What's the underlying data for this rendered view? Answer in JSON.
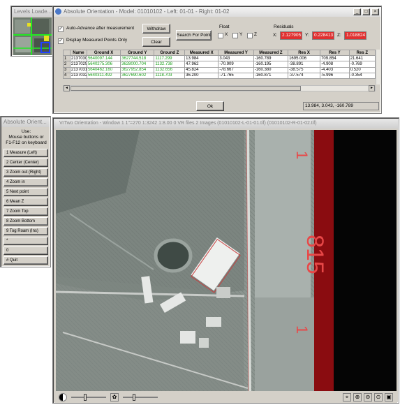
{
  "levels_window": {
    "title": "Levels Loade..."
  },
  "abs_window": {
    "title": "Absolute Orientation - Model: 01010102 - Left: 01-01 - Right: 01-02",
    "auto_advance_label": "Auto-Advance after measurement",
    "auto_advance_checked": true,
    "display_measured_label": "Display Measured Points Only",
    "display_measured_checked": true,
    "withdraw_label": "Withdraw",
    "clear_label": "Clear",
    "search_label": "Search For Point",
    "float_label": "Float",
    "float_x": "X",
    "float_y": "Y",
    "float_z": "Z",
    "residuals_label": "Residuals",
    "res_x_label": "X:",
    "res_x_value": "2.127905",
    "res_y_label": "Y:",
    "res_y_value": "0.228413",
    "res_z_label": "Z:",
    "res_z_value": "1.018824",
    "ok_label": "Ok",
    "status_coords": "13.984, 3.043, -160.789",
    "table": {
      "headers": [
        "",
        "Name",
        "Ground X",
        "Ground Y",
        "Ground Z",
        "Measured X",
        "Measured Y",
        "Measured Z",
        "Res X",
        "Res Y",
        "Res Z"
      ],
      "rows": [
        [
          "1",
          "2137030",
          "5640097.144",
          "3627744.518",
          "1117.299",
          "13.984",
          "3.043",
          "-160.789",
          "1695.006",
          "709.854",
          "21.641"
        ],
        [
          "2",
          "2137029",
          "5640275.306",
          "3628000.704",
          "1132.738",
          "47.962",
          "-70.909",
          "-160.195",
          "-38.891",
          "-4.908",
          "-0.769"
        ],
        [
          "3",
          "2137031",
          "5640462.160",
          "3627952.854",
          "1132.656",
          "45.824",
          "-78.667",
          "-160.380",
          "-38.575",
          "-4.403",
          "0.520"
        ],
        [
          "4",
          "2137032",
          "5640311.492",
          "3627690.602",
          "1118.703",
          "36.200",
          "-71.765",
          "-160.871",
          "-37.574",
          "-5.996",
          "-0.354"
        ]
      ]
    }
  },
  "side_panel": {
    "title": "Absolute Orient...",
    "instructions": [
      "Use:",
      "Mouse buttons or",
      "F1-F12 on keyboard"
    ],
    "buttons": [
      "1 Measure (Left)",
      "2 Center (Center)",
      "3 Zoom out (Right)",
      "4 Zoom in",
      "5 Next point",
      "6 Mean Z",
      "7 Zoom Top",
      "8 Zoom Bottom",
      "9 Tog Roam (Ins)",
      "*",
      "0",
      "# Quit"
    ]
  },
  "viewer": {
    "title": "VrTwo Orientation - Window 1   1\"=270   1:3242   1:8.00   0 VR files   2 Images (01010102-L-01-01.tif) (01010102-R-01-02.tif)",
    "frame_number": "815",
    "tick_marks": [
      "1",
      "1"
    ]
  },
  "colors": {
    "accent_red": "#e03030",
    "ground_green": "#18a018",
    "film_red": "#8a0c10"
  }
}
